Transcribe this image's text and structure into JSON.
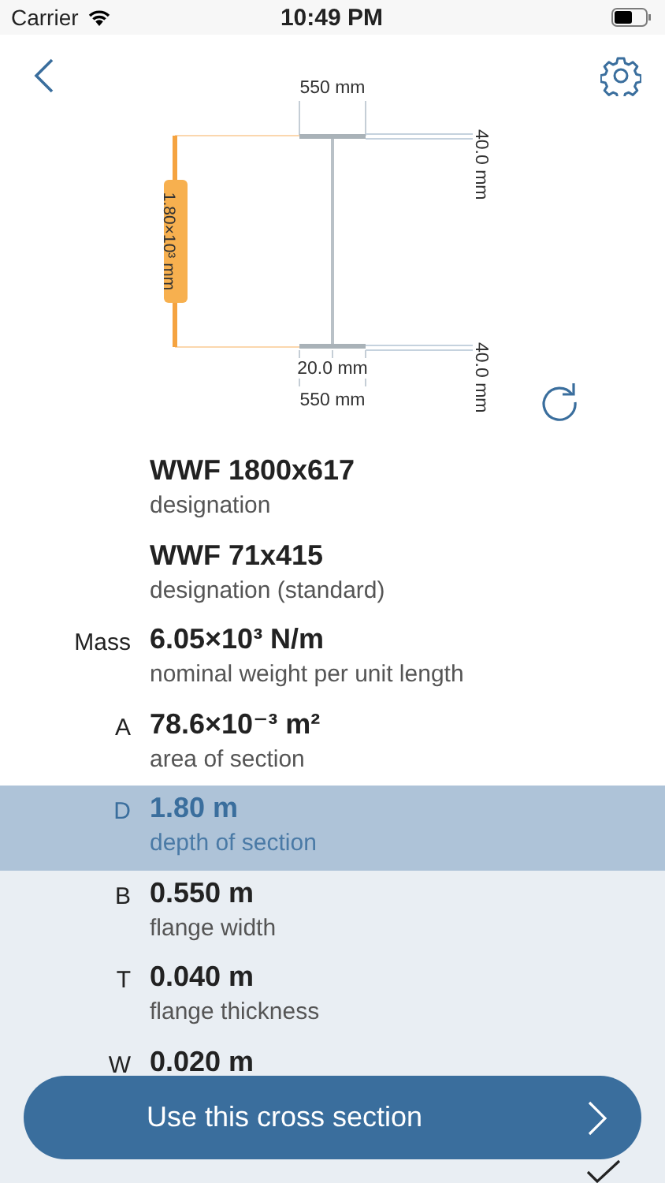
{
  "status_bar": {
    "carrier": "Carrier",
    "time": "10:49 PM"
  },
  "diagram": {
    "top_width": "550 mm",
    "top_flange_thickness": "40.0 mm",
    "depth": "1.80×10³ mm",
    "bottom_flange_thickness": "40.0 mm",
    "web_thickness": "20.0 mm",
    "bottom_width": "550 mm"
  },
  "rows": [
    {
      "value": "WWF 1800x617",
      "description": "designation",
      "selected": false
    },
    {
      "value": "WWF 71x415",
      "description": "designation (standard)",
      "selected": false
    },
    {
      "symbol": "Mass",
      "value": "6.05×10³ N/m",
      "description": "nominal weight per unit length",
      "selected": false
    },
    {
      "symbol": "A",
      "value": "78.6×10⁻³ m²",
      "description": "area of section",
      "selected": false
    },
    {
      "symbol": "D",
      "value": "1.80 m",
      "description": "depth of section",
      "selected": true
    },
    {
      "symbol": "B",
      "value": "0.550 m",
      "description": "flange width",
      "selected": false
    },
    {
      "symbol": "T",
      "value": "0.040 m",
      "description": "flange thickness",
      "selected": false
    },
    {
      "symbol": "W",
      "value": "0.020 m",
      "selected": false
    }
  ],
  "last_row": {
    "checked": true
  },
  "action_button": {
    "label": "Use this cross section"
  }
}
